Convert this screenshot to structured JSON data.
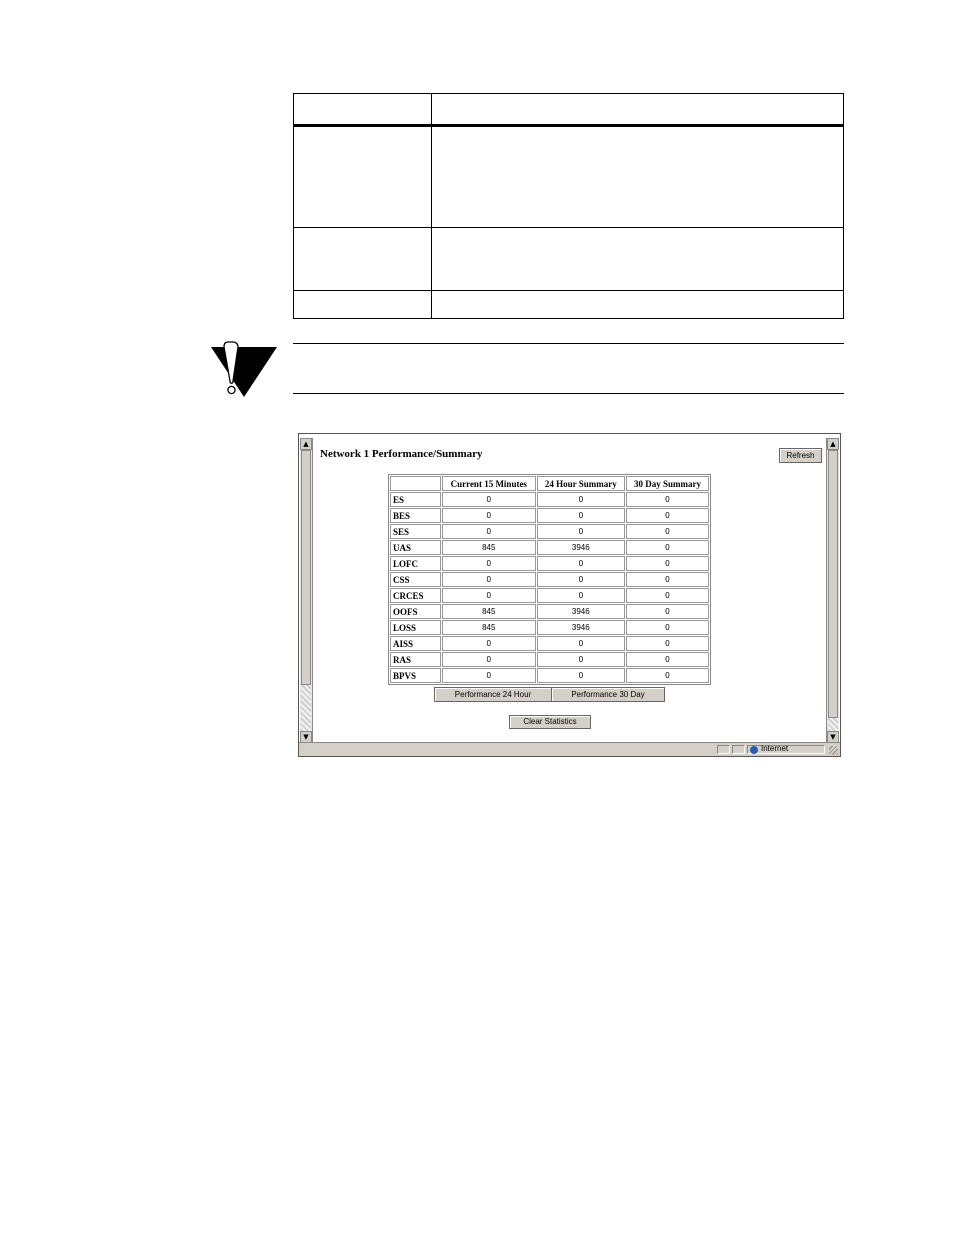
{
  "browser": {
    "title": "Network 1 Performance/Summary",
    "refresh_label": "Refresh",
    "stats": {
      "headers": [
        "",
        "Current 15 Minutes",
        "24 Hour Summary",
        "30 Day Summary"
      ],
      "rows": [
        {
          "label": "ES",
          "values": [
            "0",
            "0",
            "0"
          ]
        },
        {
          "label": "BES",
          "values": [
            "0",
            "0",
            "0"
          ]
        },
        {
          "label": "SES",
          "values": [
            "0",
            "0",
            "0"
          ]
        },
        {
          "label": "UAS",
          "values": [
            "845",
            "3946",
            "0"
          ]
        },
        {
          "label": "LOFC",
          "values": [
            "0",
            "0",
            "0"
          ]
        },
        {
          "label": "CSS",
          "values": [
            "0",
            "0",
            "0"
          ]
        },
        {
          "label": "CRCES",
          "values": [
            "0",
            "0",
            "0"
          ]
        },
        {
          "label": "OOFS",
          "values": [
            "845",
            "3946",
            "0"
          ]
        },
        {
          "label": "LOSS",
          "values": [
            "845",
            "3946",
            "0"
          ]
        },
        {
          "label": "AISS",
          "values": [
            "0",
            "0",
            "0"
          ]
        },
        {
          "label": "RAS",
          "values": [
            "0",
            "0",
            "0"
          ]
        },
        {
          "label": "BPVS",
          "values": [
            "0",
            "0",
            "0"
          ]
        }
      ]
    },
    "perf24_label": "Performance 24 Hour",
    "perf30_label": "Performance 30 Day",
    "clear_label": "Clear Statistics",
    "status": {
      "zone": "Internet"
    }
  },
  "icons": {
    "caution": "caution-icon",
    "globe": "globe-icon",
    "scroll_up": "scroll-up-arrow-icon",
    "scroll_down": "scroll-down-arrow-icon"
  }
}
